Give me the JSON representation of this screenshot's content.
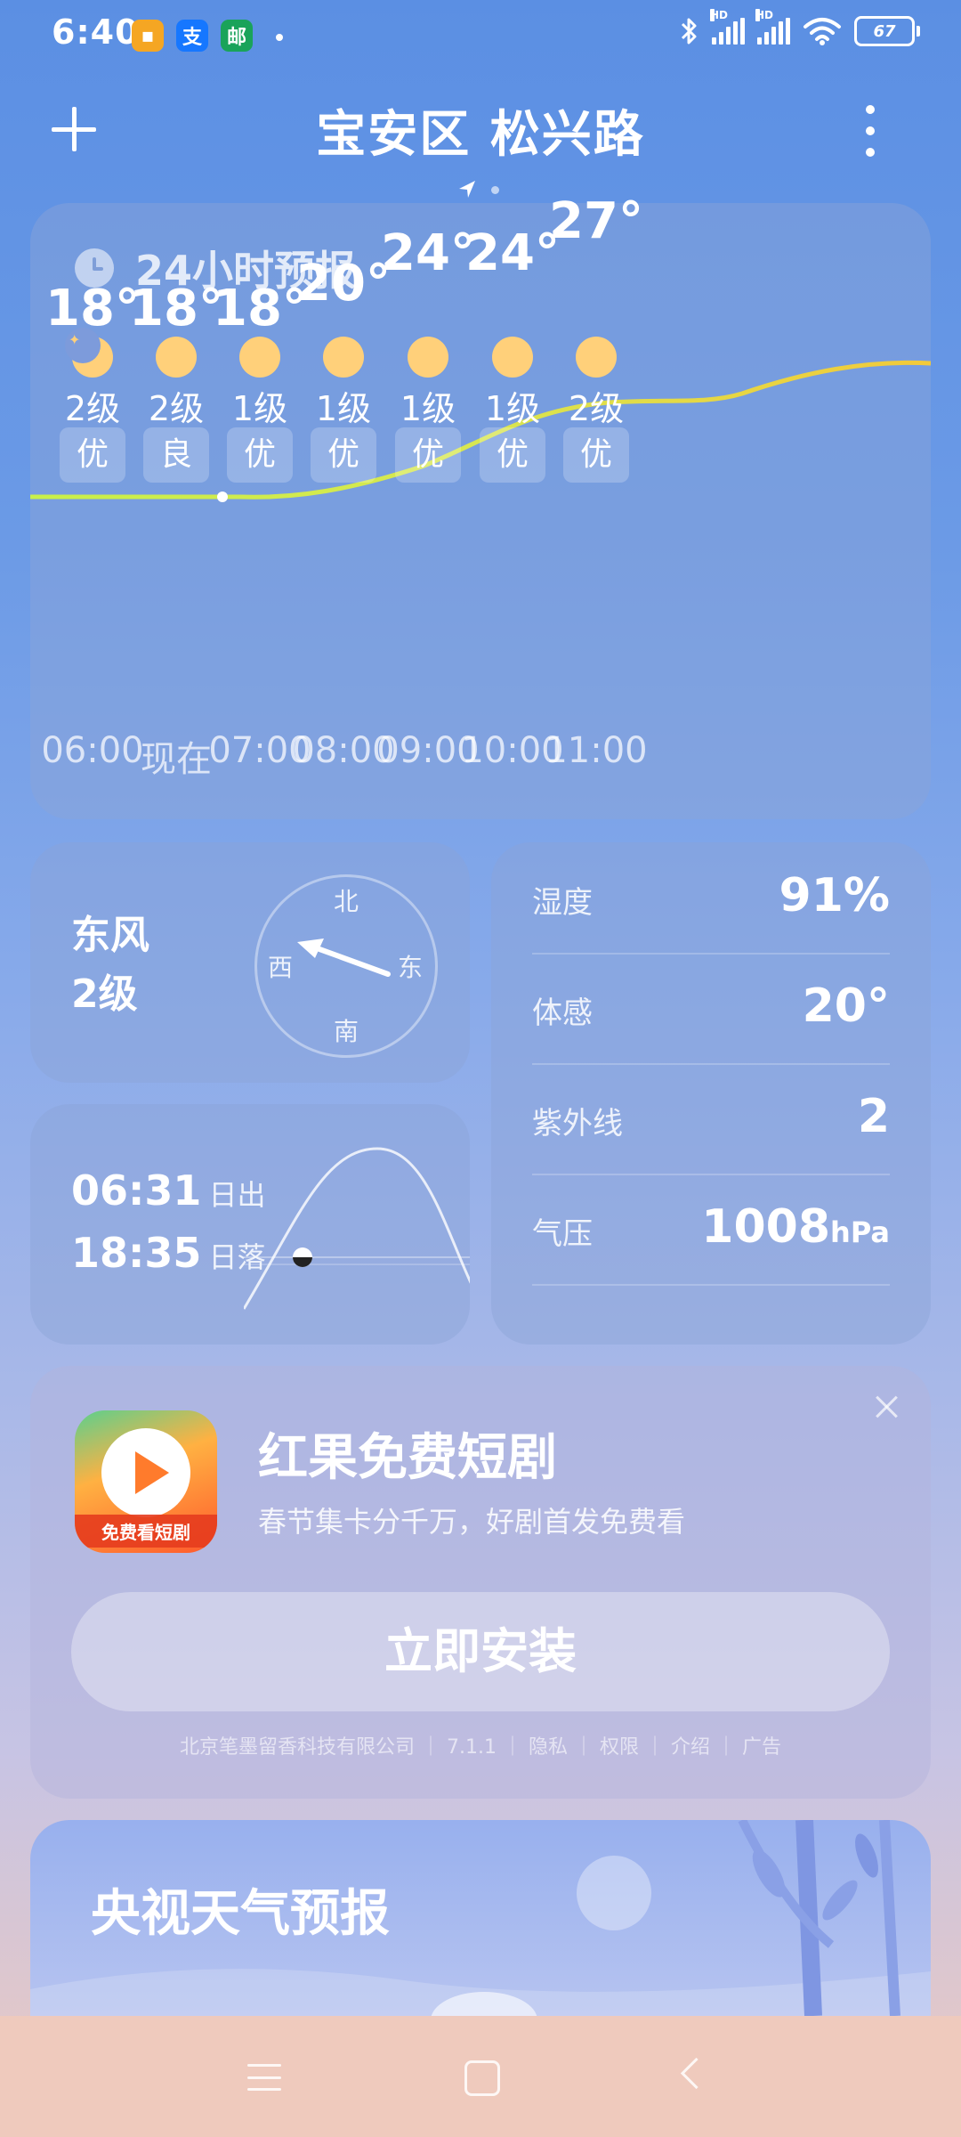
{
  "status_bar": {
    "time": "6:40",
    "apps": [
      {
        "icon": "message-icon",
        "glyph": "▪",
        "color": "#f5a623"
      },
      {
        "icon": "alipay-icon",
        "glyph": "支",
        "color": "#1677ff"
      },
      {
        "icon": "postal-icon",
        "glyph": "邮",
        "color": "#1aa35a"
      }
    ],
    "signal_label": "HD",
    "battery": "67"
  },
  "header": {
    "location": "宝安区 松兴路"
  },
  "forecast": {
    "title": "24小时预报",
    "hours": [
      {
        "temp": "18°",
        "icon": "moon-icon",
        "wind": "2级",
        "aqi": "优",
        "time": "06:00"
      },
      {
        "temp": "18°",
        "icon": "sun-icon",
        "wind": "2级",
        "aqi": "良",
        "time": "现在"
      },
      {
        "temp": "18°",
        "icon": "sun-icon",
        "wind": "1级",
        "aqi": "优",
        "time": "07:00"
      },
      {
        "temp": "20°",
        "icon": "sun-icon",
        "wind": "1级",
        "aqi": "优",
        "time": "08:00"
      },
      {
        "temp": "24°",
        "icon": "sun-icon",
        "wind": "1级",
        "aqi": "优",
        "time": "09:00"
      },
      {
        "temp": "24°",
        "icon": "sun-icon",
        "wind": "1级",
        "aqi": "优",
        "time": "10:00"
      },
      {
        "temp": "27°",
        "icon": "sun-icon",
        "wind": "2级",
        "aqi": "优",
        "time": "11:00"
      }
    ]
  },
  "wind": {
    "direction": "东风",
    "level": "2级",
    "compass": {
      "north": "北",
      "south": "南",
      "east": "东",
      "west": "西"
    }
  },
  "sun": {
    "sunrise": "06:31",
    "sunrise_label": "日出",
    "sunset": "18:35",
    "sunset_label": "日落"
  },
  "details": {
    "humidity_label": "湿度",
    "humidity": "91%",
    "feels_label": "体感",
    "feels": "20°",
    "uv_label": "紫外线",
    "uv": "2",
    "pressure_label": "气压",
    "pressure": "1008",
    "pressure_unit": "hPa"
  },
  "ad": {
    "icon_text": "免费看短剧",
    "title": "红果免费短剧",
    "description": "春节集卡分千万，好剧首发免费看",
    "button": "立即安装",
    "footer": "北京笔墨留香科技有限公司 ｜ 7.1.1 ｜ 隐私 ｜ 权限 ｜ 介绍 ｜ 广告"
  },
  "cctv": {
    "title": "央视天气预报"
  }
}
